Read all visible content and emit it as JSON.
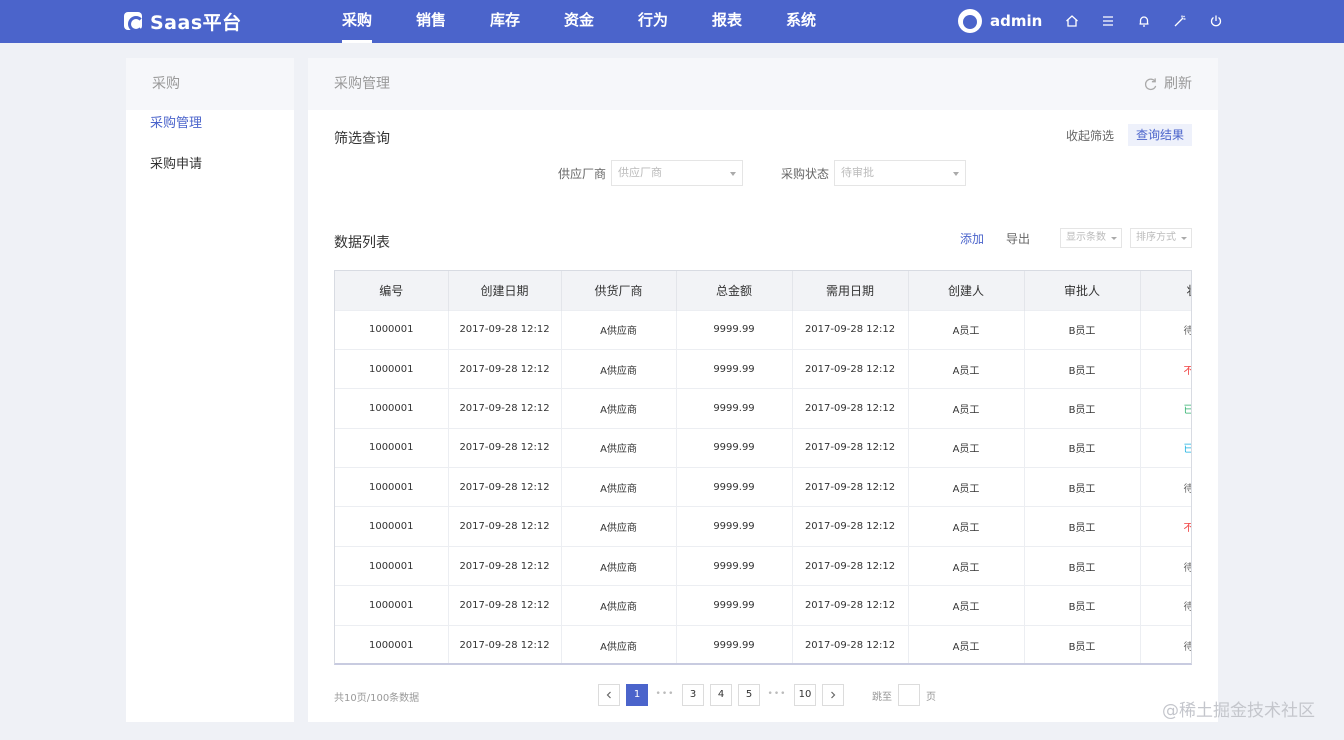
{
  "app": {
    "title": "Saas平台"
  },
  "nav": {
    "items": [
      "采购",
      "销售",
      "库存",
      "资金",
      "行为",
      "报表",
      "系统"
    ]
  },
  "user": {
    "name": "admin"
  },
  "sidebar": {
    "title": "采购",
    "items": [
      "采购管理",
      "采购申请"
    ]
  },
  "main": {
    "title": "采购管理",
    "refresh_label": "刷新"
  },
  "filter": {
    "title": "筛选查询",
    "collapse_label": "收起筛选",
    "query_label": "查询结果",
    "supplier_label": "供应厂商",
    "supplier_placeholder": "供应厂商",
    "status_label": "采购状态",
    "status_placeholder": "待审批"
  },
  "list": {
    "title": "数据列表",
    "add_label": "添加",
    "export_label": "导出",
    "display_count": "显示条数",
    "sort_mode": "排序方式"
  },
  "table": {
    "columns": [
      "编号",
      "创建日期",
      "供货厂商",
      "总金额",
      "需用日期",
      "创建人",
      "审批人",
      "状态"
    ],
    "rows": [
      [
        "1000001",
        "2017-09-28 12:12",
        "A供应商",
        "9999.99",
        "2017-09-28 12:12",
        "A员工",
        "B员工",
        "待"
      ],
      [
        "1000001",
        "2017-09-28 12:12",
        "A供应商",
        "9999.99",
        "2017-09-28 12:12",
        "A员工",
        "B员工",
        "不"
      ],
      [
        "1000001",
        "2017-09-28 12:12",
        "A供应商",
        "9999.99",
        "2017-09-28 12:12",
        "A员工",
        "B员工",
        "已"
      ],
      [
        "1000001",
        "2017-09-28 12:12",
        "A供应商",
        "9999.99",
        "2017-09-28 12:12",
        "A员工",
        "B员工",
        "已"
      ],
      [
        "1000001",
        "2017-09-28 12:12",
        "A供应商",
        "9999.99",
        "2017-09-28 12:12",
        "A员工",
        "B员工",
        "待"
      ],
      [
        "1000001",
        "2017-09-28 12:12",
        "A供应商",
        "9999.99",
        "2017-09-28 12:12",
        "A员工",
        "B员工",
        "不"
      ],
      [
        "1000001",
        "2017-09-28 12:12",
        "A供应商",
        "9999.99",
        "2017-09-28 12:12",
        "A员工",
        "B员工",
        "待"
      ],
      [
        "1000001",
        "2017-09-28 12:12",
        "A供应商",
        "9999.99",
        "2017-09-28 12:12",
        "A员工",
        "B员工",
        "待"
      ],
      [
        "1000001",
        "2017-09-28 12:12",
        "A供应商",
        "9999.99",
        "2017-09-28 12:12",
        "A员工",
        "B员工",
        "待"
      ]
    ],
    "status_classes": [
      "st-pending",
      "st-reject",
      "st-pass",
      "st-done",
      "st-pending",
      "st-reject",
      "st-pending",
      "st-pending",
      "st-pending"
    ]
  },
  "pagination": {
    "summary": "共10页/100条数据",
    "pages": [
      "1",
      "3",
      "4",
      "5",
      "10"
    ],
    "dots": "•••",
    "current": "1",
    "jump_label": "跳至",
    "jump_unit": "页"
  },
  "colors": {
    "primary": "#4b64cb",
    "reject": "#f04040",
    "pass": "#2fb26d",
    "done": "#1ab0e0"
  },
  "watermark": "@稀土掘金技术社区"
}
